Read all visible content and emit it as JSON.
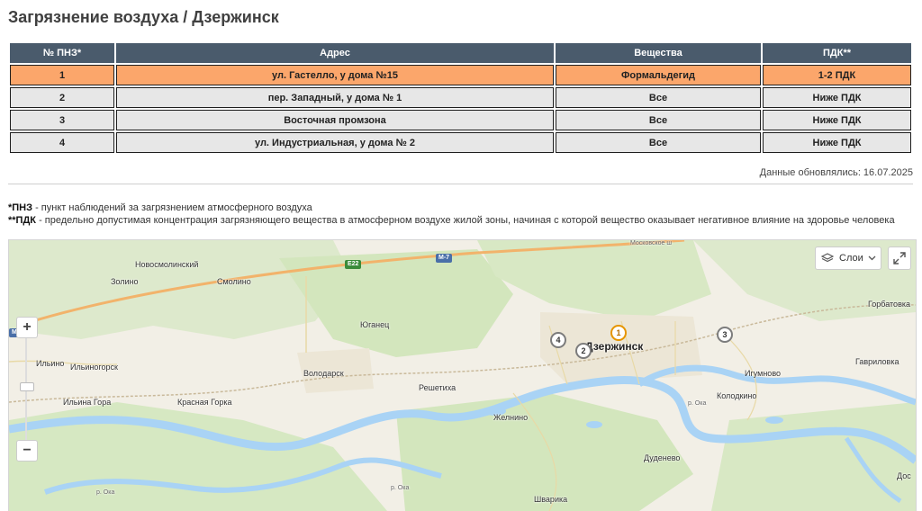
{
  "page_title": "Загрязнение воздуха / Дзержинск",
  "table": {
    "headers": [
      "№ ПНЗ*",
      "Адрес",
      "Вещества",
      "ПДК**"
    ],
    "rows": [
      {
        "num": "1",
        "address": "ул. Гастелло, у дома №15",
        "substance": "Формальдегид",
        "pdk": "1-2 ПДК",
        "highlight": true
      },
      {
        "num": "2",
        "address": "пер. Западный, у дома № 1",
        "substance": "Все",
        "pdk": "Ниже ПДК",
        "highlight": false
      },
      {
        "num": "3",
        "address": "Восточная промзона",
        "substance": "Все",
        "pdk": "Ниже ПДК",
        "highlight": false
      },
      {
        "num": "4",
        "address": "ул. Индустриальная, у дома № 2",
        "substance": "Все",
        "pdk": "Ниже ПДК",
        "highlight": false
      }
    ]
  },
  "updated": "Данные обновлялись: 16.07.2025",
  "notes": {
    "pnz_term": "*ПНЗ",
    "pnz_text": " - пункт наблюдений за загрязнением атмосферного воздуха",
    "pdk_term": "**ПДК",
    "pdk_text": " - предельно допустимая концентрация загрязняющего вещества в атмосферном воздухе жилой зоны, начиная с которой вещество оказывает негативное влияние на здоровье человека"
  },
  "map": {
    "layers_label": "Слои",
    "zoom_in": "+",
    "zoom_out": "−",
    "city": "Дзержинск",
    "places": {
      "novosmolinsky": "Новосмолинский",
      "zolino": "Золино",
      "smolino": "Смолино",
      "yuganets": "Юганец",
      "ilino": "Ильино",
      "ilinogorsk": "Ильиногорск",
      "ilina_gora": "Ильина Гора",
      "krasnaya_gorka": "Красная Горка",
      "volodarsk": "Володарск",
      "reshetikha": "Решетиха",
      "zhelnino": "Желнино",
      "gorbatovka": "Горбатовка",
      "gavrilovka": "Гавриловка",
      "igumnovo": "Игумново",
      "kolodkino": "Колодкино",
      "dudenevo": "Дуденево",
      "shvarikha": "Шварика",
      "dos": "Дос",
      "moskovskoe": "Московское ш",
      "oka1": "р. Ока",
      "oka2": "р. Ока",
      "oka3": "р. Ока"
    },
    "shields": {
      "e22": "E22",
      "m7": "М-7",
      "m7b": "М"
    },
    "markers": [
      "1",
      "2",
      "3",
      "4"
    ],
    "colors": {
      "water": "#a9d3f5",
      "forest": "#d6e8c2",
      "road": "#f2b36b",
      "marker_active": "#e69500"
    }
  }
}
